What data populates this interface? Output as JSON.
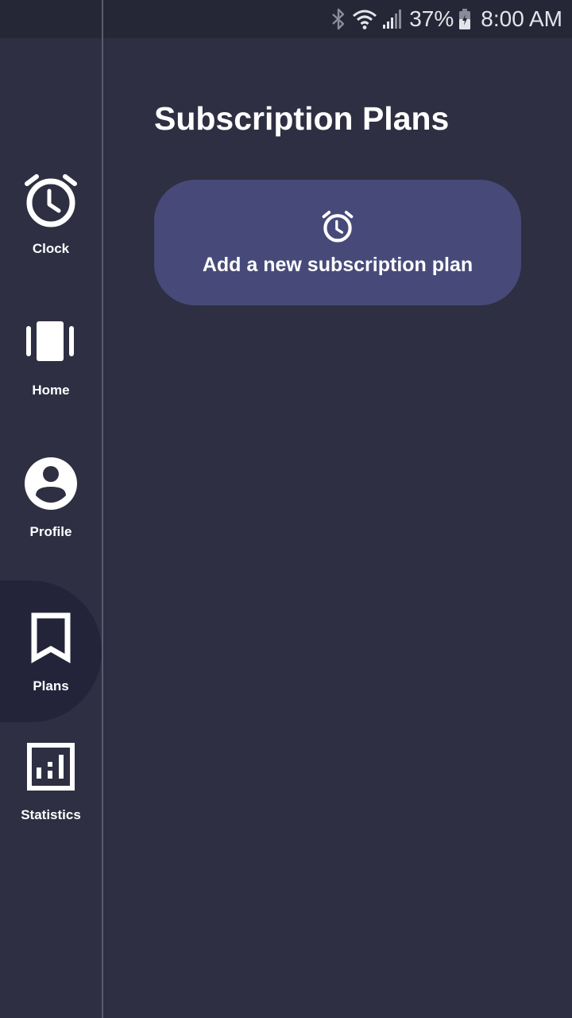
{
  "status_bar": {
    "battery_percent": "37%",
    "time": "8:00 AM",
    "icons": [
      "bluetooth-icon",
      "wifi-icon",
      "signal-icon",
      "battery-icon"
    ]
  },
  "nav_rail": {
    "items": [
      {
        "label": "Clock",
        "icon": "alarm-clock-icon",
        "active": false
      },
      {
        "label": "Home",
        "icon": "carousel-icon",
        "active": false
      },
      {
        "label": "Profile",
        "icon": "account-circle-icon",
        "active": false
      },
      {
        "label": "Plans",
        "icon": "bookmark-icon",
        "active": true
      },
      {
        "label": "Statistics",
        "icon": "bar-chart-icon",
        "active": false
      }
    ]
  },
  "main": {
    "title": "Subscription Plans",
    "add_card": {
      "icon": "alarm-clock-icon",
      "label": "Add a new subscription plan"
    }
  },
  "colors": {
    "background": "#2e2f42",
    "status_bar": "#262736",
    "active_rail_item": "#23243a",
    "card": "#474a79",
    "text": "#ffffff"
  }
}
